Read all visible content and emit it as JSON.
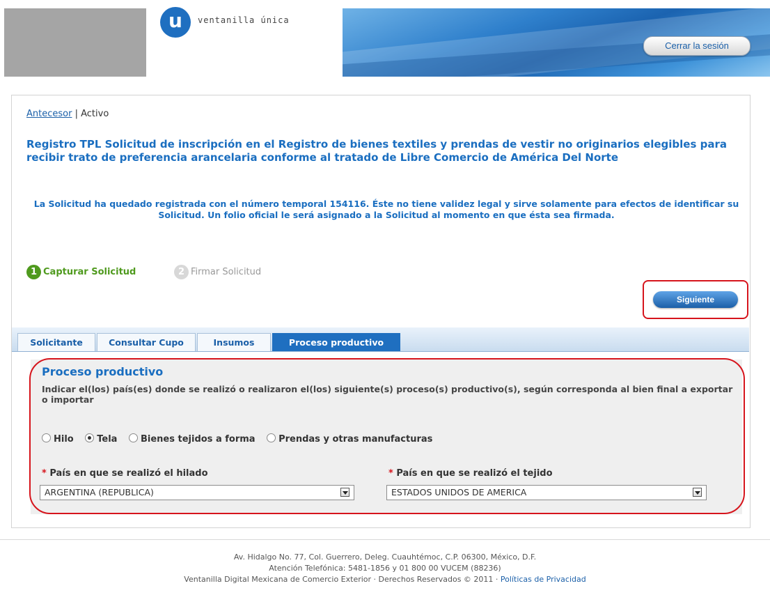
{
  "header": {
    "logo_letter": "u",
    "brand": "ventanilla única",
    "logout_label": "Cerrar la sesión"
  },
  "breadcrumb": {
    "link": "Antecesor",
    "separator": "|",
    "current": "Activo"
  },
  "page_title": "Registro TPL Solicitud de inscripción en el Registro de bienes textiles y prendas de vestir no originarios elegibles para recibir trato de preferencia arancelaria conforme al tratado de Libre Comercio de América Del Norte",
  "notice": "La Solicitud ha quedado registrada con el número temporal 154116. Éste no tiene validez legal y sirve solamente para efectos de identificar su Solicitud. Un folio oficial le será asignado a la Solicitud al momento en que ésta sea firmada.",
  "steps": [
    {
      "num": "1",
      "label": "Capturar Solicitud"
    },
    {
      "num": "2",
      "label": "Firmar Solicitud"
    }
  ],
  "next_label": "Siguiente",
  "tabs": [
    {
      "label": "Solicitante"
    },
    {
      "label": "Consultar Cupo"
    },
    {
      "label": "Insumos"
    },
    {
      "label": "Proceso productivo"
    }
  ],
  "section": {
    "title": "Proceso productivo",
    "description": "Indicar el(los) país(es) donde se realizó o realizaron el(los) siguiente(s) proceso(s) productivo(s), según corresponda al bien final a exportar o importar",
    "radios": [
      {
        "label": "Hilo",
        "checked": false
      },
      {
        "label": "Tela",
        "checked": true
      },
      {
        "label": "Bienes tejidos a forma",
        "checked": false
      },
      {
        "label": "Prendas y otras manufacturas",
        "checked": false
      }
    ],
    "field1": {
      "required_mark": "*",
      "label": "País en que se realizó el hilado",
      "value": "ARGENTINA (REPUBLICA)"
    },
    "field2": {
      "required_mark": "*",
      "label": "País en que se realizó el tejido",
      "value": "ESTADOS UNIDOS DE AMERICA"
    }
  },
  "footer": {
    "address": "Av. Hidalgo No. 77, Col. Guerrero, Deleg. Cuauhtémoc, C.P. 06300, México, D.F.",
    "phone": "Atención Telefónica: 5481-1856 y 01 800 00 VUCEM (88236)",
    "rights": "Ventanilla Digital Mexicana de Comercio Exterior · Derechos Reservados © 2011 ·",
    "privacy": "Políticas de Privacidad"
  }
}
